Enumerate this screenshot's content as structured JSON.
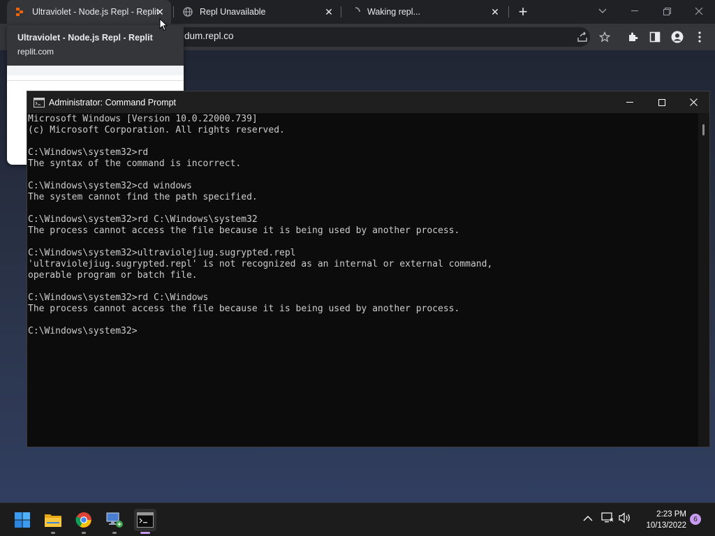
{
  "browser": {
    "tabs": [
      {
        "title": "Ultraviolet - Node.js Repl - Replit",
        "active": true
      },
      {
        "title": "Repl Unavailable",
        "active": false
      },
      {
        "title": "Waking repl...",
        "active": false
      }
    ],
    "address_text": "dum.repl.co",
    "tooltip": {
      "title": "Ultraviolet - Node.js Repl - Replit",
      "url": "replit.com"
    }
  },
  "cmd": {
    "title": "Administrator: Command Prompt",
    "lines": [
      "Microsoft Windows [Version 10.0.22000.739]",
      "(c) Microsoft Corporation. All rights reserved.",
      "",
      "C:\\Windows\\system32>rd",
      "The syntax of the command is incorrect.",
      "",
      "C:\\Windows\\system32>cd windows",
      "The system cannot find the path specified.",
      "",
      "C:\\Windows\\system32>rd C:\\Windows\\system32",
      "The process cannot access the file because it is being used by another process.",
      "",
      "C:\\Windows\\system32>ultraviolejiug.sugrypted.repl",
      "'ultraviolejiug.sugrypted.repl' is not recognized as an internal or external command,",
      "operable program or batch file.",
      "",
      "C:\\Windows\\system32>rd C:\\Windows",
      "The process cannot access the file because it is being used by another process.",
      "",
      "C:\\Windows\\system32>"
    ]
  },
  "taskbar": {
    "apps": [
      "start-icon",
      "file-explorer-icon",
      "chrome-icon",
      "network-computer-icon",
      "command-prompt-icon"
    ],
    "time": "2:23 PM",
    "date": "10/13/2022",
    "notification_count": "6"
  },
  "colors": {
    "cmd_background": "#0c0c0c",
    "cmd_text": "#cccccc",
    "accent": "#c79cf0"
  }
}
